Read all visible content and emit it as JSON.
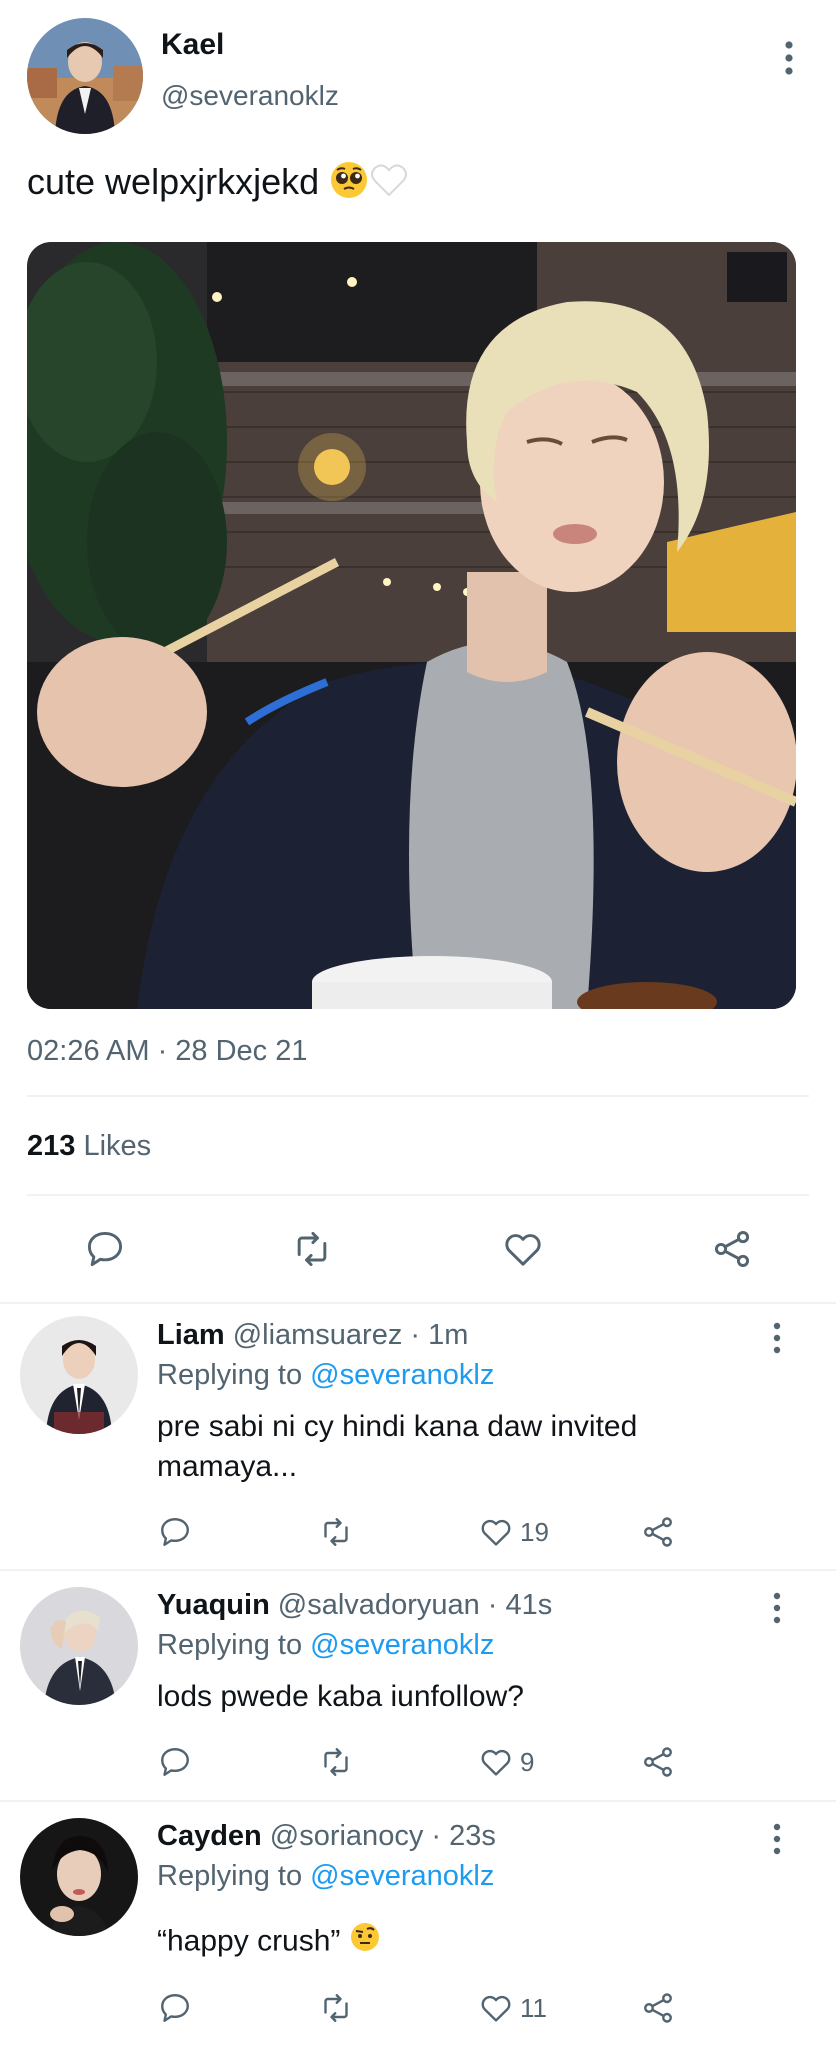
{
  "tweet": {
    "author_name": "Kael",
    "author_handle": "@severanoklz",
    "text": "cute welpxjrkxjekd",
    "timestamp": "02:26 AM · 28 Dec 21",
    "likes_count": "213",
    "likes_label": "Likes"
  },
  "replies": [
    {
      "name": "Liam",
      "handle_time": "@liamsuarez · 1m",
      "replying_prefix": "Replying to",
      "replying_to": "@severanoklz",
      "text": "pre sabi ni cy hindi kana daw invited mamaya...",
      "likes": "19"
    },
    {
      "name": "Yuaquin",
      "handle_time": "@salvadoryuan · 41s",
      "replying_prefix": "Replying to",
      "replying_to": "@severanoklz",
      "text": "lods pwede kaba iunfollow?",
      "likes": "9"
    },
    {
      "name": "Cayden",
      "handle_time": "@sorianocy · 23s",
      "replying_prefix": "Replying to",
      "replying_to": "@severanoklz",
      "text": "“happy crush”",
      "likes": "11"
    }
  ],
  "colors": {
    "link": "#1d9bf0",
    "secondary_text": "#536471",
    "divider": "#eff3f4"
  },
  "icons": [
    "more-vertical-icon",
    "reply-icon",
    "retweet-icon",
    "heart-icon",
    "share-icon",
    "pleading-face-emoji",
    "white-heart-emoji",
    "raised-eyebrow-emoji"
  ]
}
